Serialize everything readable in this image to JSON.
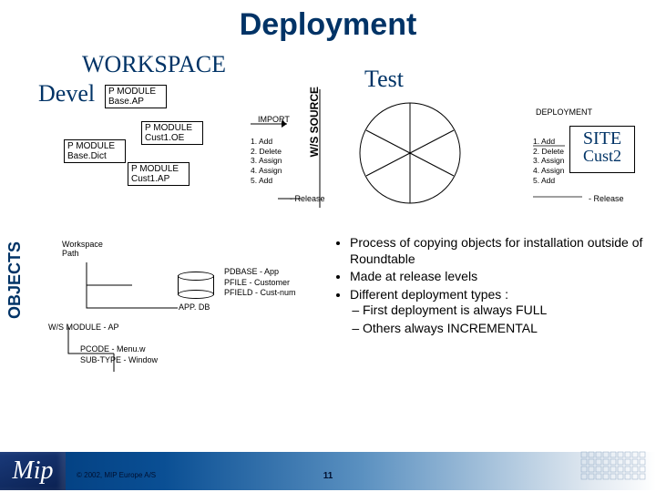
{
  "title": "Deployment",
  "workspace": "WORKSPACE",
  "devel": "Devel",
  "test": "Test",
  "objects_vlabel": "OBJECTS",
  "wssource_vlabel": "W/S SOURCE",
  "pmodule": {
    "baseap": "P MODULE",
    "baseap_sub": "Base.AP",
    "basedict": "P MODULE",
    "basedict_sub": "Base.Dict",
    "custoe": "P MODULE",
    "custoe_sub": "Cust1.OE",
    "custap": "P MODULE",
    "custap_sub": "Cust1.AP"
  },
  "import": "IMPORT",
  "ops": {
    "l1": "1. Add",
    "l2": "2. Delete",
    "l3": "3. Assign",
    "l4": "4. Assign",
    "l5": "5. Add"
  },
  "release": "- Release",
  "deployment_lbl": "DEPLOYMENT",
  "site": "SITE",
  "cust2": "Cust2",
  "workspace_path": "Workspace\nPath",
  "appdb": "APP. DB",
  "pdbase": "PDBASE - App",
  "pfile": "PFILE - Customer",
  "pfield": "PFIELD - Cust-num",
  "wsmodule": "W/S MODULE - AP",
  "pcode": "PCODE - Menu.w",
  "subtype": "SUB-TYPE - Window",
  "bullets": {
    "b1": "Process of copying objects for installation outside of Roundtable",
    "b2": "Made at release levels",
    "b3": "Different deployment types :",
    "b3a": "First deployment is always FULL",
    "b3b": "Others always INCREMENTAL"
  },
  "logo": "Mip",
  "copyright": "© 2002, MIP Europe A/S",
  "page": "11"
}
